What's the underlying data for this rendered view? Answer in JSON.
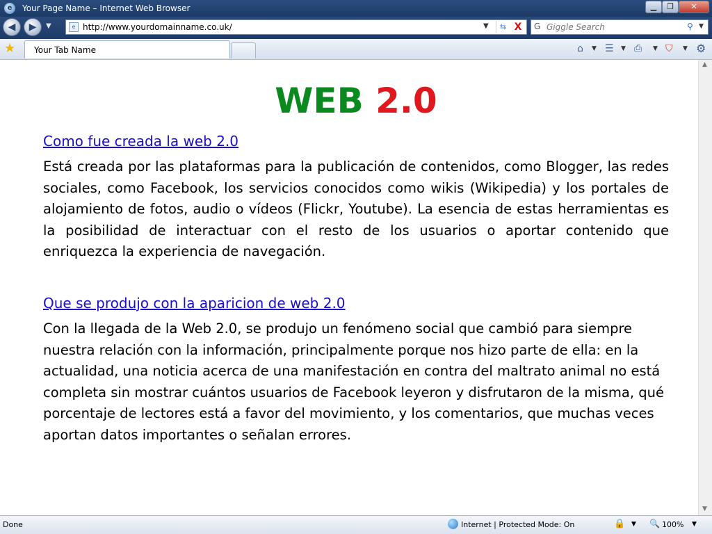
{
  "window": {
    "title": "Your Page Name – Internet Web Browser",
    "min_label": "▁",
    "max_label": "❐",
    "close_label": "✕"
  },
  "nav": {
    "back_glyph": "◀",
    "forward_glyph": "▶",
    "history_drop": "▼",
    "address_value": "http://www.yourdomainname.co.uk/",
    "address_drop": "▼",
    "refresh_glyph": "⇆",
    "stop_glyph": "X",
    "search_provider_glyph": "G",
    "search_placeholder": "Giggle Search",
    "search_glyph": "⚲",
    "search_drop": "▼"
  },
  "tabs": {
    "star_glyph": "★",
    "active_tab_label": "Your Tab Name"
  },
  "toolbar": {
    "home_glyph": "⌂",
    "feeds_glyph": "☰",
    "print_glyph": "⎙",
    "safety_glyph": "⛉",
    "tools_glyph": "⚙",
    "drop": "▼"
  },
  "page": {
    "title_part1": "WEB",
    "title_part2": "2.0",
    "section1_link": "Como fue creada la web 2.0",
    "section1_text": "Está creada por las plataformas para la publicación de contenidos, como Blogger, las redes sociales, como Facebook, los servicios conocidos como wikis (Wikipedia) y los portales de alojamiento de fotos, audio o vídeos (Flickr, Youtube). La esencia de estas herramientas es la posibilidad de interactuar con el resto de los usuarios o aportar contenido que enriquezca la experiencia de navegación.",
    "section2_link": "Que se produjo con la aparicion de web 2.0",
    "section2_text": "Con la llegada de la Web 2.0, se produjo un fenómeno social que cambió para siempre nuestra relación con la información, principalmente porque nos hizo parte de ella: en la actualidad, una noticia acerca de una manifestación en contra del maltrato animal no está completa sin mostrar cuántos usuarios de Facebook leyeron y disfrutaron de la misma, qué porcentaje de lectores está a favor del movimiento, y los comentarios, que muchas veces aportan datos importantes o señalan errores."
  },
  "scroll": {
    "up_glyph": "▲",
    "down_glyph": "▼"
  },
  "status": {
    "done": "Done",
    "zone": "Internet | Protected Mode: On",
    "lock_glyph": "🔒",
    "zoom_glyph": "🔍",
    "zoom": "100%",
    "drop": "▼"
  },
  "colors": {
    "title_green": "#0a8a1e",
    "title_red": "#e0171c",
    "link_blue": "#1a0dcc"
  }
}
